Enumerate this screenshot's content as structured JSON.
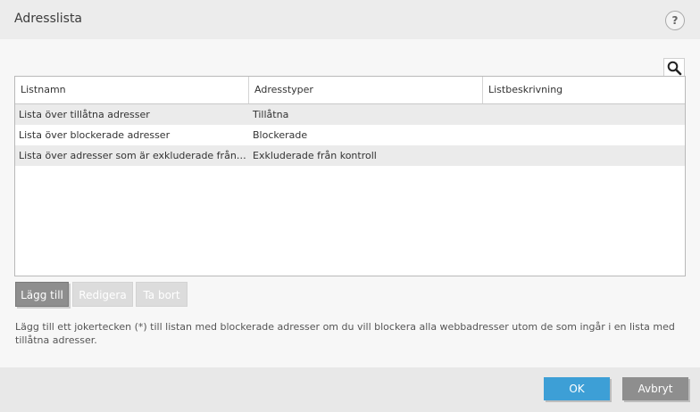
{
  "window": {
    "title": "Adresslista",
    "help_label": "?"
  },
  "search": {
    "icon": "search-icon"
  },
  "table": {
    "columns": [
      "Listnamn",
      "Adresstyper",
      "Listbeskrivning"
    ],
    "rows": [
      [
        "Lista över tillåtna adresser",
        "Tillåtna",
        ""
      ],
      [
        "Lista över blockerade adresser",
        "Blockerade",
        ""
      ],
      [
        "Lista över adresser som är exkluderade från kontroll",
        "Exkluderade från kontroll",
        ""
      ]
    ]
  },
  "toolbar": {
    "add_label": "Lägg till",
    "edit_label": "Redigera",
    "delete_label": "Ta bort"
  },
  "info_text": "Lägg till ett jokertecken (*) till listan med blockerade adresser om du vill blockera alla webbadresser utom de som ingår i en lista med tillåtna adresser.",
  "footer": {
    "ok_label": "OK",
    "cancel_label": "Avbryt"
  },
  "colors": {
    "accent": "#3d9fd6",
    "button_gray": "#8e8e8e",
    "disabled_gray": "#dcdcdc"
  }
}
